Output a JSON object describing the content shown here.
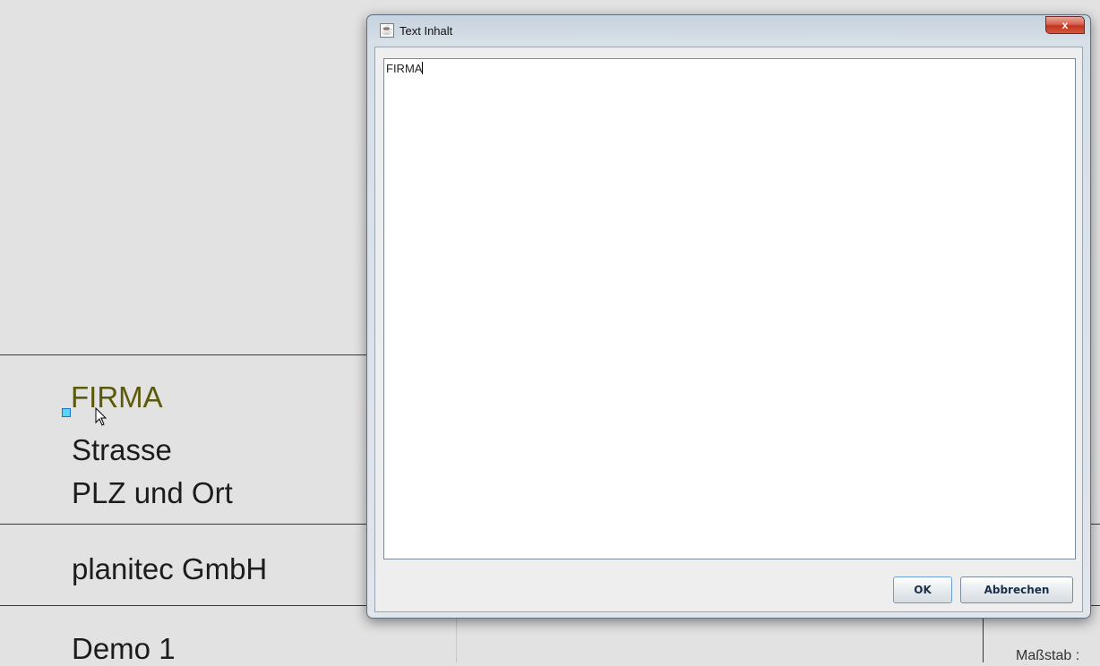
{
  "drawing": {
    "company_label": "FIRMA",
    "street_label": "Strasse",
    "city_label": "PLZ und Ort",
    "company_name": "planitec GmbH",
    "project_name": "Demo 1",
    "scale_label": "Maßstab :"
  },
  "dialog": {
    "title": "Text Inhalt",
    "text_value": "FIRMA",
    "ok_label": "OK",
    "cancel_label": "Abbrechen",
    "close_symbol": "x",
    "app_icon": "java-icon"
  },
  "colors": {
    "firma_text": "#5b5a0c",
    "selection_handle": "#5cd3f5",
    "close_button": "#c2361e"
  }
}
